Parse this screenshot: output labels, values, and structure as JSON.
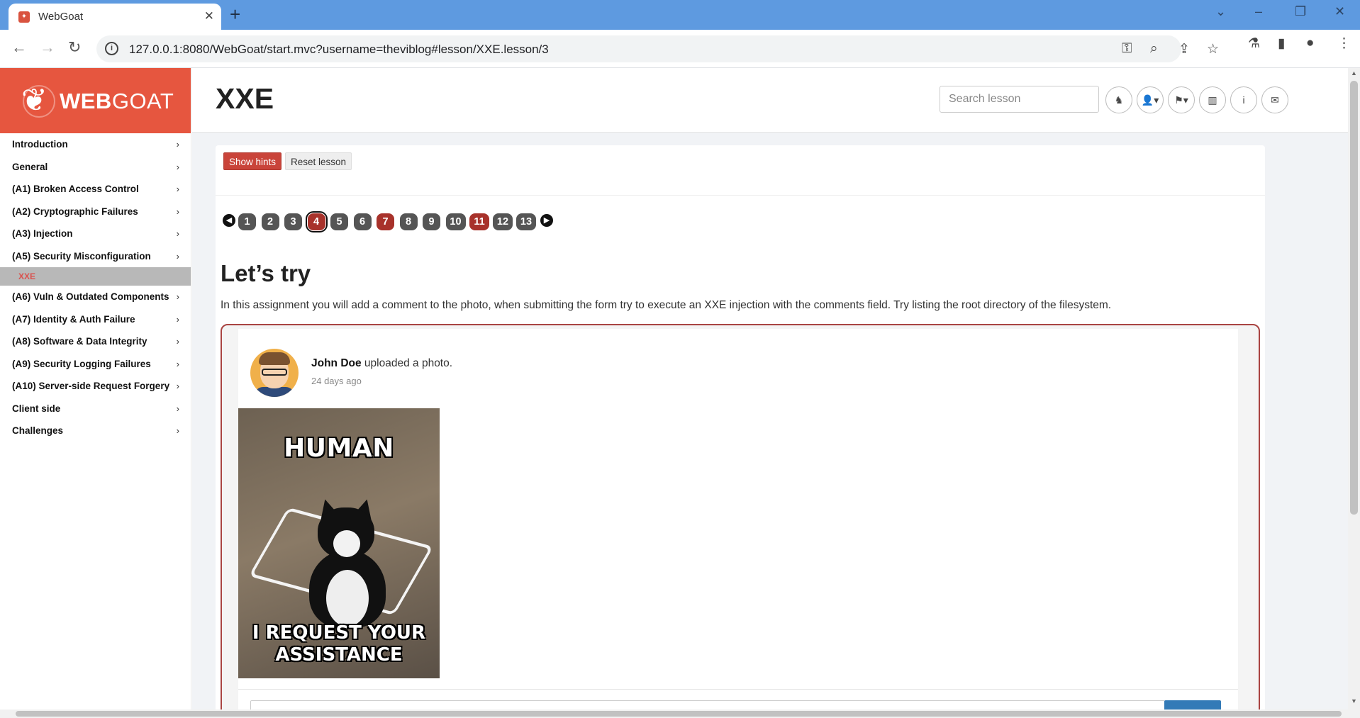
{
  "browser": {
    "tab_title": "WebGoat",
    "url": "127.0.0.1:8080/WebGoat/start.mvc?username=theviblog#lesson/XXE.lesson/3",
    "accent_color": "#5e9ae0"
  },
  "sidebar": {
    "logo_bold": "WEB",
    "logo_light": "GOAT",
    "brand_color": "#e6563f",
    "items": [
      {
        "label": "Introduction"
      },
      {
        "label": "General"
      },
      {
        "label": "(A1) Broken Access Control"
      },
      {
        "label": "(A2) Cryptographic Failures"
      },
      {
        "label": "(A3) Injection"
      },
      {
        "label": "(A5) Security Misconfiguration"
      },
      {
        "label": "(A6) Vuln & Outdated Components"
      },
      {
        "label": "(A7) Identity & Auth Failure"
      },
      {
        "label": "(A8) Software & Data Integrity"
      },
      {
        "label": "(A9) Security Logging Failures"
      },
      {
        "label": "(A10) Server-side Request Forgery"
      },
      {
        "label": "Client side"
      },
      {
        "label": "Challenges"
      }
    ],
    "active_sub": "XXE"
  },
  "header": {
    "title": "XXE",
    "search_placeholder": "Search lesson"
  },
  "lesson": {
    "show_hints": "Show hints",
    "reset": "Reset lesson",
    "pages": [
      "1",
      "2",
      "3",
      "4",
      "5",
      "6",
      "7",
      "8",
      "9",
      "10",
      "11",
      "12",
      "13"
    ],
    "current_page": "4",
    "heading": "Let’s try",
    "description": "In this assignment you will add a comment to the photo, when submitting the form try to execute an XXE injection with the comments field. Try listing the root directory of the filesystem."
  },
  "post": {
    "author": "John Doe",
    "action": " uploaded a photo.",
    "time": "24 days ago",
    "meme_top": "HUMAN",
    "meme_bottom_1": "I REQUEST YOUR",
    "meme_bottom_2": "ASSISTANCE"
  }
}
